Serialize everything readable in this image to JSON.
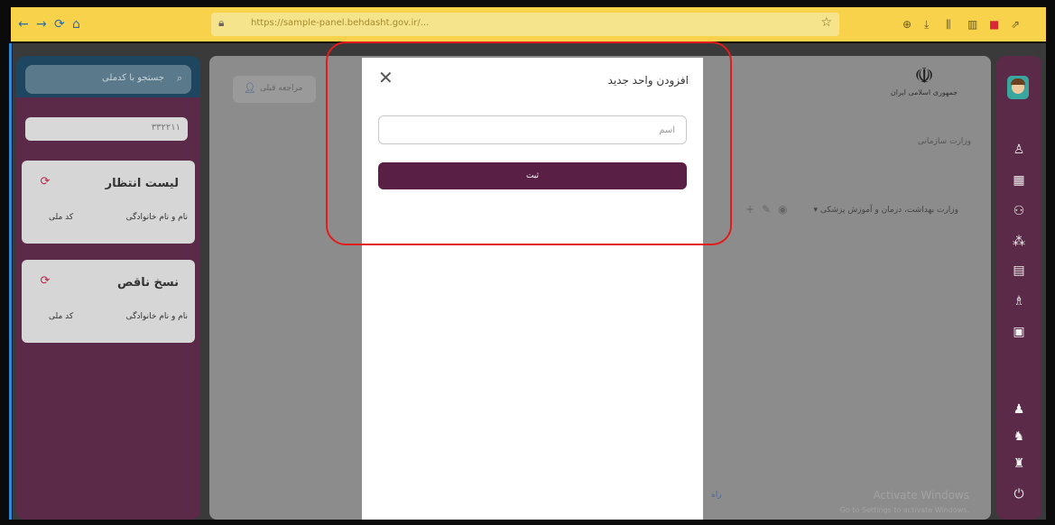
{
  "browser": {
    "url": "https://sample-panel.behdasht.gov.ir/...",
    "nav": [
      "←",
      "→",
      "⟳",
      "⌂"
    ],
    "star": "☆",
    "extensions": [
      "⊕",
      "⤓",
      "⫼",
      "▥",
      "■",
      "⇗"
    ]
  },
  "left_panel": {
    "search_placeholder": "جستجو با کدملی",
    "id_value": "۳۳۲۲۱۱",
    "cards": [
      {
        "title": "لیست انتظار",
        "col1": "نام و نام خانوادگی",
        "col2": "کد ملی"
      },
      {
        "title": "نسخ ناقص",
        "col1": "نام و نام خانوادگی",
        "col2": "کد ملی"
      }
    ]
  },
  "main": {
    "prev_button": "مراجعه قبلی",
    "emblem_name": "جمهوری اسلامی ایران",
    "subtitle": "وزارت سازمانی",
    "tree_row": "▾ وزارت بهداشت، درمان و آموزش پزشکی",
    "watermark_title": "Activate Windows",
    "watermark_sub": "Go to Settings to activate Windows.",
    "edge_link": "راه"
  },
  "modal": {
    "title": "افزودن واحد جدید",
    "close": "✕",
    "input_placeholder": "اسم",
    "submit_label": "ثبت"
  },
  "right_sidebar": {
    "icons": [
      "user-icon",
      "building-icon",
      "users-icon",
      "network-icon",
      "document-icon",
      "person-badge-icon",
      "file-icon",
      "user-add-icon",
      "user-check-icon",
      "users-manage-icon",
      "power-icon"
    ]
  }
}
